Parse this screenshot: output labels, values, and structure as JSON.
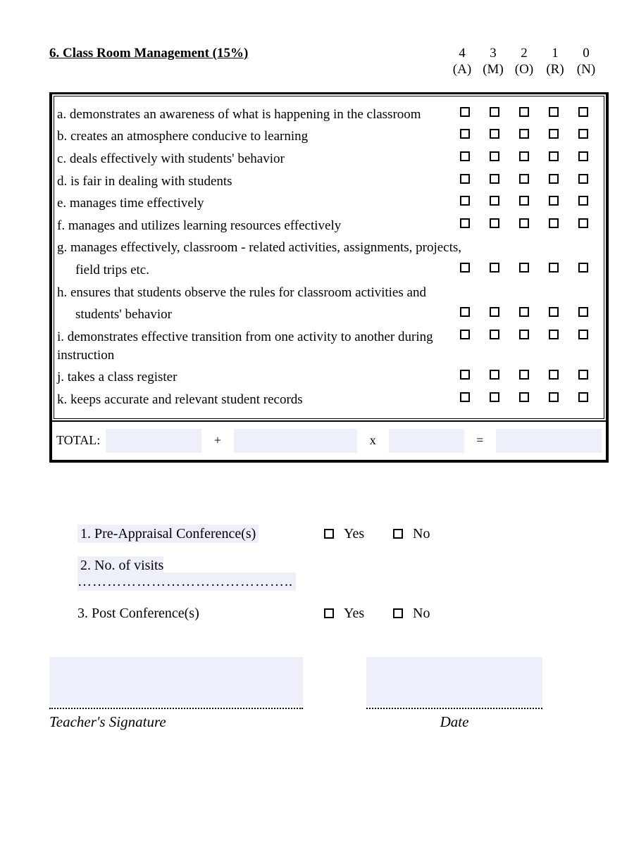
{
  "section": {
    "title": "6. Class Room Management (15%)",
    "scale": [
      {
        "num": "4",
        "letter": "(A)"
      },
      {
        "num": "3",
        "letter": "(M)"
      },
      {
        "num": "2",
        "letter": "(O)"
      },
      {
        "num": "1",
        "letter": "(R)"
      },
      {
        "num": "0",
        "letter": "(N)"
      }
    ],
    "items": {
      "a": "a. demonstrates an awareness of what is happening in the classroom",
      "b": "b.  creates an atmosphere conducive to learning",
      "c": "c. deals effectively with students' behavior",
      "d": "d.  is fair in dealing with students",
      "e": "e. manages time effectively",
      "f": "f. manages and utilizes learning resources effectively",
      "g1": "g.  manages effectively, classroom - related activities, assignments, projects,",
      "g2": "field trips etc.",
      "h1": "h.  ensures that students observe the rules for classroom activities and",
      "h2": "students' behavior",
      "i": "i. demonstrates effective transition from one activity to another during instruction",
      "j": "j. takes a class register",
      "k": "k. keeps accurate and relevant student records"
    },
    "total_label": "TOTAL:",
    "ops": {
      "plus": "+",
      "times": "x",
      "eq": "="
    }
  },
  "questions": {
    "q1": "1.  Pre-Appraisal Conference(s)",
    "q2": "2.  No. of visits",
    "q2dots": "……………………………………..",
    "q3": "3.  Post Conference(s)",
    "yes": "Yes",
    "no": "No"
  },
  "signature": {
    "teacher": "Teacher's Signature",
    "date": "Date"
  }
}
